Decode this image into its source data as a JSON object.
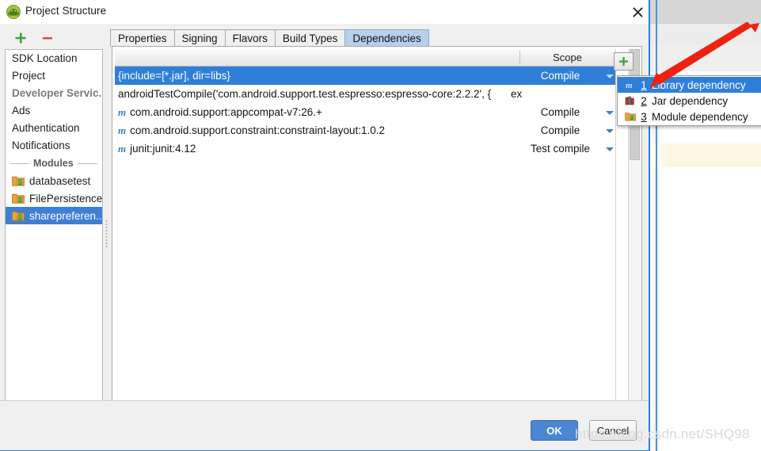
{
  "window": {
    "title": "Project Structure",
    "icon": "android-studio-icon",
    "close_label": "✕"
  },
  "left_toolbar": {
    "add_label": "+",
    "remove_label": "−"
  },
  "sidebar": {
    "items": [
      {
        "label": "SDK Location",
        "muted": false
      },
      {
        "label": "Project",
        "muted": false
      },
      {
        "label": "Developer Servic...",
        "muted": true
      },
      {
        "label": "Ads",
        "muted": false
      },
      {
        "label": "Authentication",
        "muted": false
      },
      {
        "label": "Notifications",
        "muted": false
      }
    ],
    "section_label": "Modules",
    "modules": [
      {
        "label": "databasetest",
        "selected": false
      },
      {
        "label": "FilePersistence",
        "selected": false
      },
      {
        "label": "sharepreferen...",
        "selected": true
      }
    ]
  },
  "tabs": [
    {
      "label": "Properties",
      "active": false
    },
    {
      "label": "Signing",
      "active": false
    },
    {
      "label": "Flavors",
      "active": false
    },
    {
      "label": "Build Types",
      "active": false
    },
    {
      "label": "Dependencies",
      "active": true
    }
  ],
  "table": {
    "headers": {
      "name": "",
      "scope": "Scope"
    },
    "rows": [
      {
        "icon": "",
        "name": "{include=[*.jar], dir=libs}",
        "scope": "Compile",
        "selected": true,
        "has_caret": true,
        "overflow": ""
      },
      {
        "icon": "",
        "name": "androidTestCompile('com.android.support.test.espresso:espresso-core:2.2.2', {",
        "scope": "",
        "selected": false,
        "has_caret": false,
        "overflow": "ex"
      },
      {
        "icon": "m",
        "name": "com.android.support:appcompat-v7:26.+",
        "scope": "Compile",
        "selected": false,
        "has_caret": true,
        "overflow": ""
      },
      {
        "icon": "m",
        "name": "com.android.support.constraint:constraint-layout:1.0.2",
        "scope": "Compile",
        "selected": false,
        "has_caret": true,
        "overflow": ""
      },
      {
        "icon": "m",
        "name": "junit:junit:4.12",
        "scope": "Test compile",
        "selected": false,
        "has_caret": true,
        "overflow": ""
      }
    ]
  },
  "add_dependency_button": {
    "label": "+"
  },
  "popup_menu": {
    "items": [
      {
        "num": "1",
        "label": "Library dependency",
        "icon": "maven-m-icon",
        "selected": true
      },
      {
        "num": "2",
        "label": "Jar dependency",
        "icon": "jar-books-icon",
        "selected": false
      },
      {
        "num": "3",
        "label": "Module dependency",
        "icon": "module-folder-icon",
        "selected": false
      }
    ]
  },
  "footer": {
    "ok_label": "OK",
    "cancel_label": "Cancel"
  },
  "watermark": {
    "text": "https://blog.csdn.net/SHQ98"
  },
  "colors": {
    "selection_blue": "#2f7fd9",
    "tab_active_blue": "#b6cfeb",
    "ok_button_blue": "#4a86d4",
    "add_green": "#3fa13f",
    "remove_red": "#d04a3d",
    "arrow_red": "#ee2211",
    "caret_line_yellow": "#fdf6e3"
  }
}
